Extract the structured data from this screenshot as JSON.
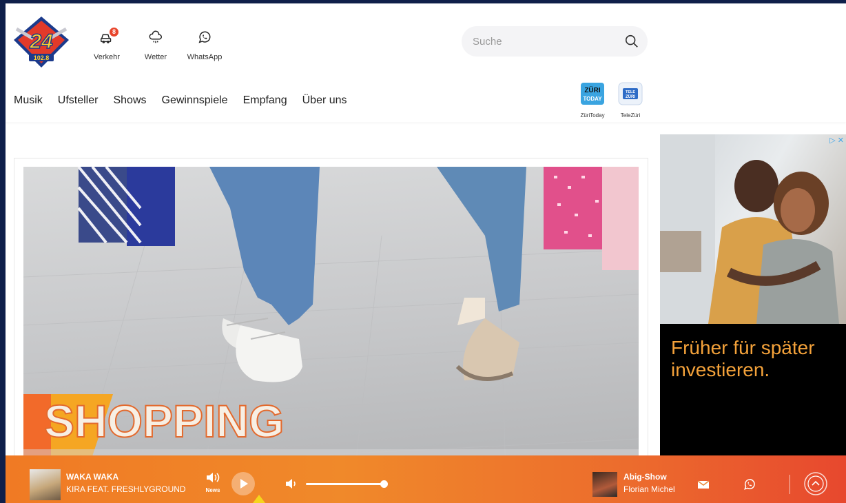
{
  "header": {
    "logo": {
      "text": "24",
      "subtext": "102.8",
      "alt": "Radio 24"
    },
    "quick_links": [
      {
        "label": "Verkehr",
        "icon": "car-icon",
        "badge": "8"
      },
      {
        "label": "Wetter",
        "icon": "cloud-rain-icon"
      },
      {
        "label": "WhatsApp",
        "icon": "whatsapp-icon"
      }
    ],
    "search": {
      "placeholder": "Suche",
      "icon": "search-icon"
    },
    "nav": [
      "Musik",
      "Ufsteller",
      "Shows",
      "Gewinnspiele",
      "Empfang",
      "Über uns"
    ],
    "partners": [
      {
        "label": "ZüriToday",
        "logo_text": "ZÜRI TODAY"
      },
      {
        "label": "TeleZüri",
        "logo_text": "TELE ZÜRI"
      }
    ]
  },
  "hero": {
    "overlay_text": "SHOPPING"
  },
  "ad": {
    "headline": "Früher für später investieren.",
    "badge": "▷ ✕"
  },
  "player": {
    "track_title": "WAKA WAKA",
    "track_artist": "KIRA FEAT. FRESHLYGROUND",
    "news_label": "News",
    "volume": 0.97,
    "show_name": "Abig-Show",
    "host_name": "Florian Michel",
    "colors": {
      "start": "#f07a24",
      "end": "#e7482e"
    }
  }
}
